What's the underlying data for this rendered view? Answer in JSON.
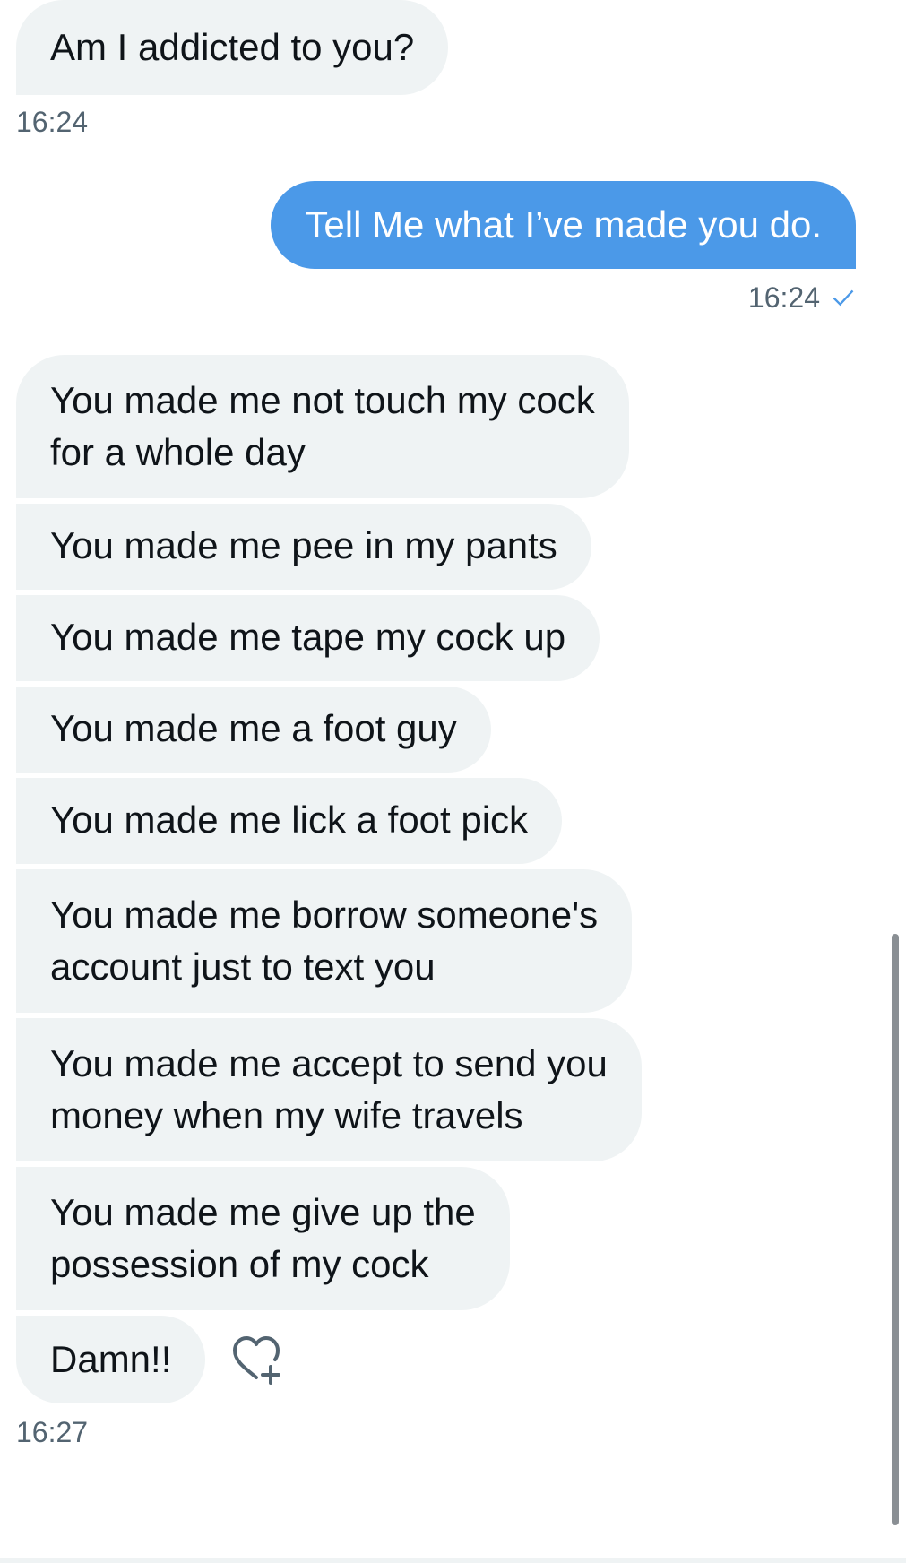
{
  "messages": {
    "m1": "Am I addicted to you?",
    "t1": "16:24",
    "m2": "Tell Me what I’ve made you do.",
    "t2": "16:24",
    "m3": "You made me not touch my cock\nfor a whole day",
    "m4": "You made me pee in my pants",
    "m5": "You made me tape my cock up",
    "m6": "You made me a foot guy",
    "m7": "You made me lick a foot pick",
    "m8": "You made me borrow someone's\naccount just to text you",
    "m9": "You made me accept to send you\nmoney when my wife travels",
    "m10": "You made me give up the\npossession of my cock",
    "m11": "Damn!!",
    "t3": "16:27"
  },
  "icons": {
    "sent_check": "check-icon",
    "react": "heart-plus-icon"
  },
  "colors": {
    "incoming_bubble": "#eff3f4",
    "outgoing_bubble": "#4b99e8",
    "timestamp": "#536471",
    "check": "#4b99e8"
  }
}
